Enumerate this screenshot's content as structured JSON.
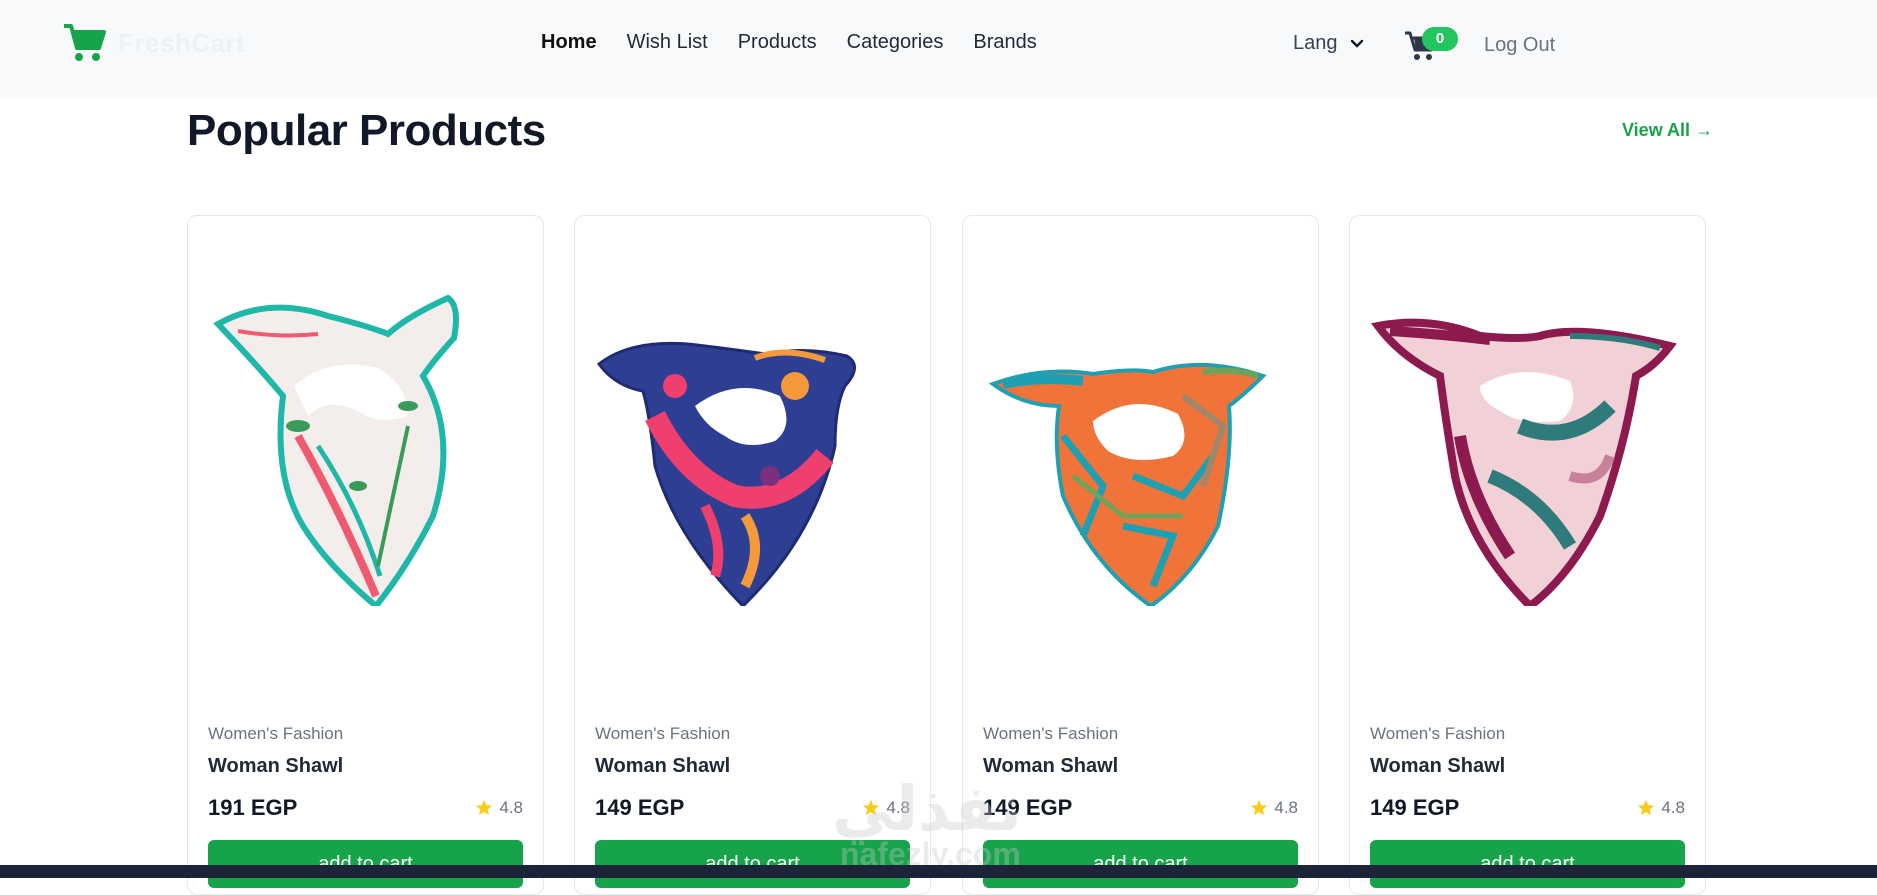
{
  "brand": {
    "name": "FreshCart",
    "accent": "#16a34a"
  },
  "nav": {
    "links": [
      {
        "label": "Home",
        "active": true
      },
      {
        "label": "Wish List",
        "active": false
      },
      {
        "label": "Products",
        "active": false
      },
      {
        "label": "Categories",
        "active": false
      },
      {
        "label": "Brands",
        "active": false
      }
    ],
    "lang_label": "Lang",
    "cart_count": "0",
    "logout_label": "Log Out"
  },
  "section": {
    "title": "Popular Products",
    "view_all": "View All →"
  },
  "products": [
    {
      "category": "Women's Fashion",
      "title": "Woman Shawl",
      "price": "191 EGP",
      "rating": "4.8",
      "button": "add to cart",
      "palette": [
        "#f3eeec",
        "#1fb7a8",
        "#ef5b6e",
        "#3a9a5a"
      ]
    },
    {
      "category": "Women's Fashion",
      "title": "Woman Shawl",
      "price": "149 EGP",
      "rating": "4.8",
      "button": "add to cart",
      "palette": [
        "#2e3f93",
        "#ef3f6e",
        "#f59a3a",
        "#7b2f7e"
      ]
    },
    {
      "category": "Women's Fashion",
      "title": "Woman Shawl",
      "price": "149 EGP",
      "rating": "4.8",
      "button": "add to cart",
      "palette": [
        "#f0743a",
        "#1f9fb2",
        "#6fa35b",
        "#a0876a"
      ]
    },
    {
      "category": "Women's Fashion",
      "title": "Woman Shawl",
      "price": "149 EGP",
      "rating": "4.8",
      "button": "add to cart",
      "palette": [
        "#8c1a4f",
        "#f2d1d6",
        "#2f7a7a",
        "#c9809a"
      ]
    }
  ],
  "watermark": {
    "arabic": "نفذلي",
    "latin": "nafezly.com"
  }
}
